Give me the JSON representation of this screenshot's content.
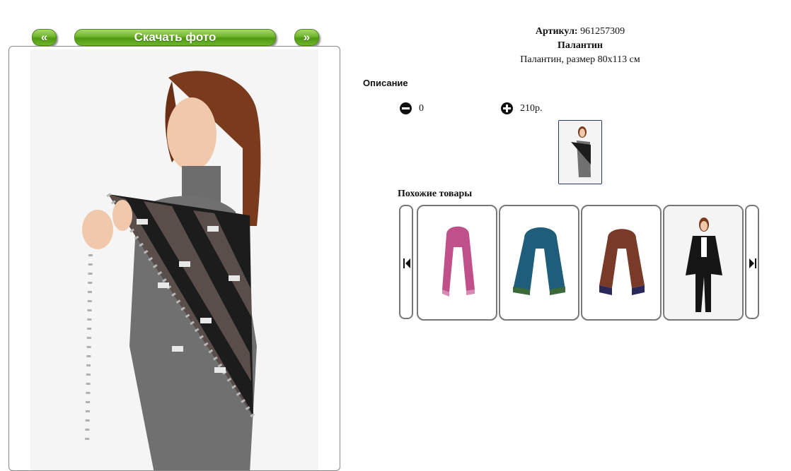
{
  "nav": {
    "prev": "«",
    "download": "Скачать фото",
    "next": "»"
  },
  "product": {
    "article_label": "Артикул:",
    "article_value": " 961257309",
    "name": "Палантин",
    "description_text": "Палантин, размер 80х113 см",
    "description_heading": "Описание",
    "quantity": "0",
    "price": "210р."
  },
  "similar": {
    "heading": "Похожие товары",
    "items": [
      {
        "icon": "pink-scarf-image"
      },
      {
        "icon": "teal-scarf-image"
      },
      {
        "icon": "brown-paisley-scarf-image"
      },
      {
        "icon": "black-wrap-model-image"
      }
    ]
  },
  "colors": {
    "button_green": "#6fb52c",
    "frame_gray": "#777777",
    "thumb_border": "#233a60"
  }
}
